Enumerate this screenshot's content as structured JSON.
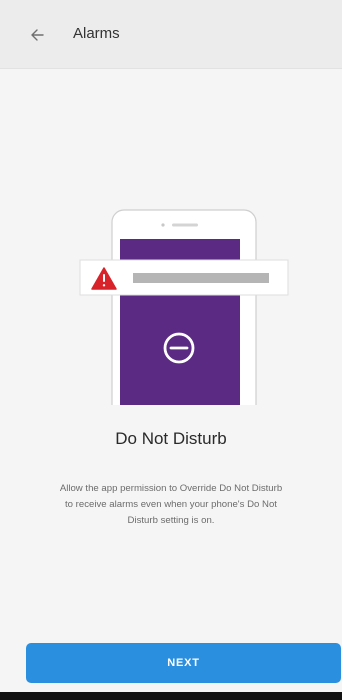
{
  "header": {
    "title": "Alarms",
    "back_icon": "arrow-left-icon"
  },
  "illustration": {
    "warning_icon": "warning-triangle-icon",
    "dnd_icon": "minus-circle-icon",
    "colors": {
      "phone_screen": "#5b2a83",
      "warning": "#d8232a",
      "bar": "#b5b5b5"
    }
  },
  "content": {
    "title": "Do Not Disturb",
    "description": "Allow the app permission to Override Do Not Disturb to receive alarms even when your phone's Do Not Disturb setting is on."
  },
  "footer": {
    "next_label": "NEXT",
    "accent_color": "#2b8fe0"
  }
}
